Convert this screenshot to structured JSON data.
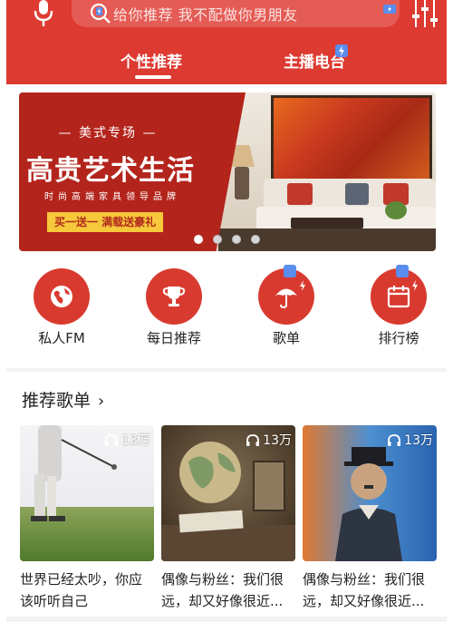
{
  "colors": {
    "brand_red": "#dd3a31",
    "search_bg": "#e45c55",
    "badge_blue": "#5a8dee"
  },
  "header": {
    "search_placeholder": "给你推荐 我不配做你男朋友",
    "tabs": [
      {
        "label": "个性推荐",
        "active": true
      },
      {
        "label": "主播电台",
        "active": false
      }
    ]
  },
  "banner": {
    "subtitle": "— 美式专场 —",
    "title": "高贵艺术生活",
    "tagline": "时尚高端家具领导品牌",
    "promo": "买一送一  满载送豪礼",
    "slide_count": 4,
    "active_slide": 1
  },
  "quick_links": [
    {
      "label": "私人FM",
      "icon": "globe-icon"
    },
    {
      "label": "每日推荐",
      "icon": "trophy-icon"
    },
    {
      "label": "歌单",
      "icon": "umbrella-icon"
    },
    {
      "label": "排行榜",
      "icon": "calendar-icon"
    }
  ],
  "section": {
    "title": "推荐歌单",
    "chevron": "›"
  },
  "playlists": [
    {
      "title": "世界已经太吵，你应该听听自己",
      "plays": "13万"
    },
    {
      "title": "偶像与粉丝：我们很远，却又好像很近...",
      "plays": "13万"
    },
    {
      "title": "偶像与粉丝：我们很远，却又好像很近...",
      "plays": "13万"
    }
  ]
}
